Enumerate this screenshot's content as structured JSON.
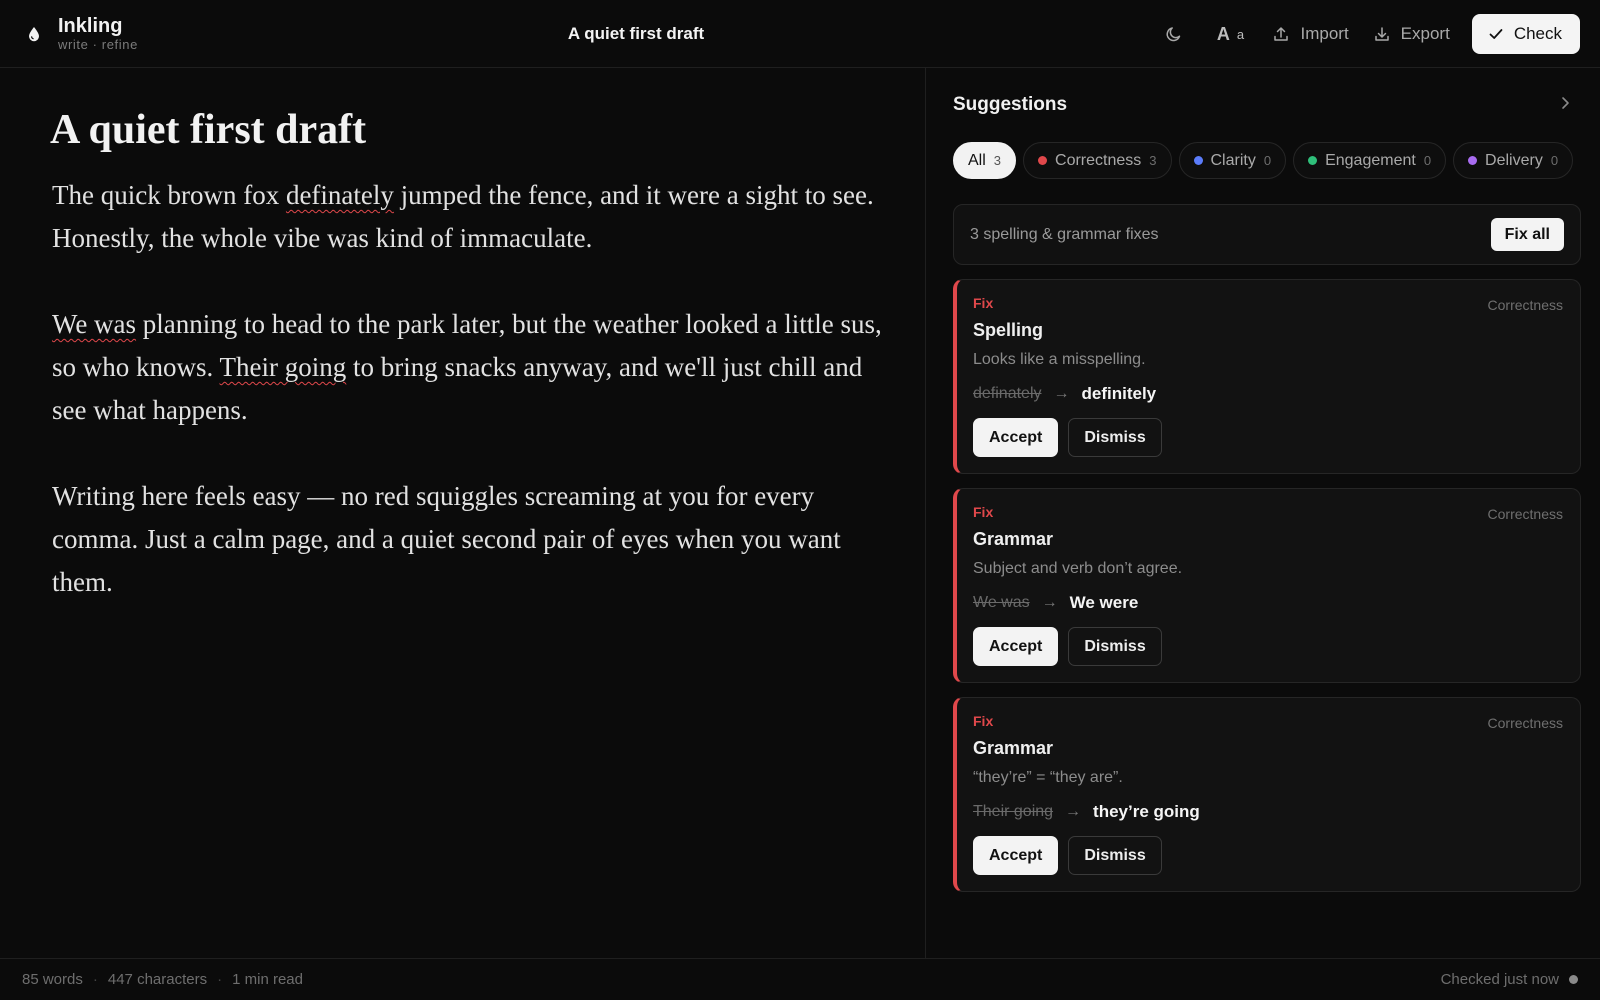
{
  "app": {
    "name": "Inkling",
    "tagline": "write · refine",
    "document_title": "A quiet first draft"
  },
  "toolbar": {
    "font_big": "A",
    "font_small": "a",
    "import_label": "Import",
    "export_label": "Export",
    "check_label": "Check"
  },
  "editor": {
    "title": "A quiet first draft",
    "p1": {
      "before": "The quick brown fox ",
      "flag": "definately",
      "after": " jumped the fence, and it were a sight to see. Honestly, the whole vibe was kind of immaculate."
    },
    "p2": {
      "flag1": "We was",
      "mid": " planning to head to the park later, but the weather looked a little sus, so who knows. ",
      "flag2": "Their going",
      "after": " to bring snacks anyway, and we'll just chill and see what happens."
    },
    "p3": "Writing here feels easy — no red squiggles screaming at you for every comma. Just a calm page, and a quiet second pair of eyes when you want them."
  },
  "suggestions": {
    "title": "Suggestions",
    "filters": [
      {
        "label": "All",
        "count": "3",
        "color": null
      },
      {
        "label": "Correctness",
        "count": "3",
        "color": "#e0484b"
      },
      {
        "label": "Clarity",
        "count": "0",
        "color": "#5b7cfa"
      },
      {
        "label": "Engagement",
        "count": "0",
        "color": "#2fbf7a"
      },
      {
        "label": "Delivery",
        "count": "0",
        "color": "#a86cf0"
      }
    ],
    "summary_text": "3 spelling & grammar fixes",
    "fix_all_label": "Fix all",
    "cards": [
      {
        "kind": "Fix",
        "category": "Correctness",
        "heading": "Spelling",
        "description": "Looks like a misspelling.",
        "original": "definately",
        "replacement": "definitely",
        "accept": "Accept",
        "dismiss": "Dismiss"
      },
      {
        "kind": "Fix",
        "category": "Correctness",
        "heading": "Grammar",
        "description": "Subject and verb don’t agree.",
        "original": "We was",
        "replacement": "We were",
        "accept": "Accept",
        "dismiss": "Dismiss"
      },
      {
        "kind": "Fix",
        "category": "Correctness",
        "heading": "Grammar",
        "description": "“they’re” = “they are”.",
        "original": "Their going",
        "replacement": "they’re going",
        "accept": "Accept",
        "dismiss": "Dismiss"
      }
    ]
  },
  "status": {
    "words": "85 words",
    "characters": "447 characters",
    "read_time": "1 min read",
    "separator": "·",
    "checked": "Checked just now"
  },
  "colors": {
    "accent_error": "#e0484b",
    "clarity": "#5b7cfa",
    "engagement": "#2fbf7a",
    "delivery": "#a86cf0"
  },
  "icons": [
    "ink-drop-icon",
    "moon-icon",
    "upload-icon",
    "download-icon",
    "check-icon",
    "chevron-right-icon"
  ]
}
